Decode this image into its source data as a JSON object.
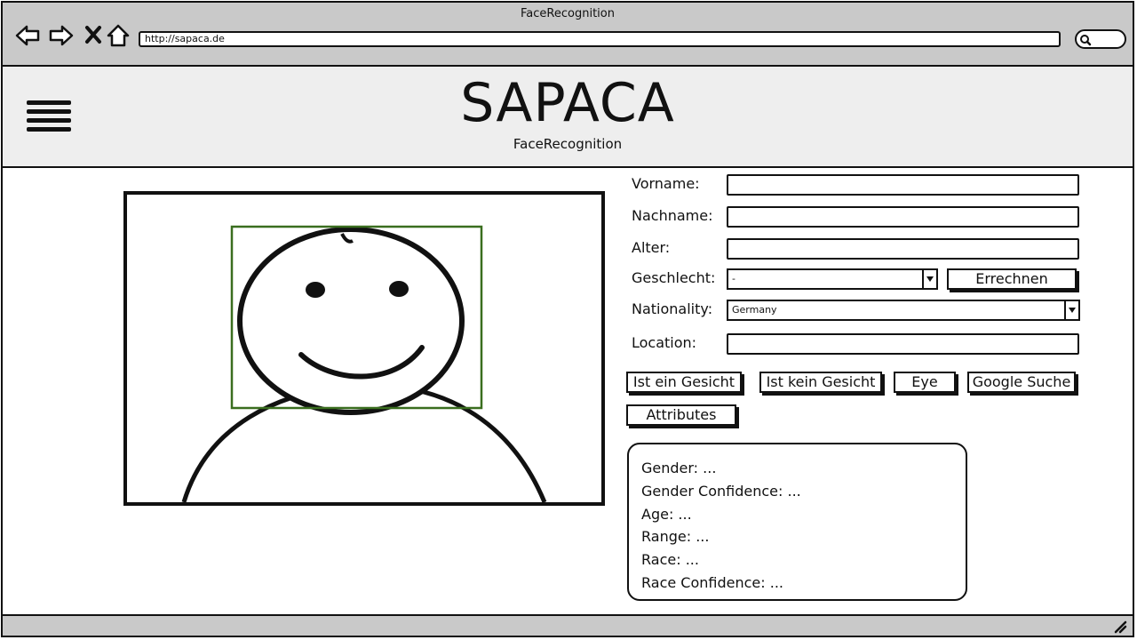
{
  "window": {
    "title": "FaceRecognition"
  },
  "browser": {
    "url": "http://sapaca.de"
  },
  "header": {
    "brand": "SAPACA",
    "subtitle": "FaceRecognition"
  },
  "form": {
    "vorname_label": "Vorname:",
    "nachname_label": "Nachname:",
    "alter_label": "Alter:",
    "geschlecht_label": "Geschlecht:",
    "geschlecht_value": "-",
    "errechnen_label": "Errechnen",
    "nationality_label": "Nationality:",
    "nationality_value": "Germany",
    "location_label": "Location:"
  },
  "actions": {
    "ist_ein_gesicht": "Ist ein Gesicht",
    "ist_kein_gesicht": "Ist kein Gesicht",
    "eye": "Eye",
    "google_suche": "Google Suche",
    "attributes": "Attributes"
  },
  "results": [
    "Gender: ...",
    "Gender Confidence: ...",
    "Age: ...",
    "Range: ...",
    "Race: ...",
    "Race Confidence: ..."
  ],
  "colors": {
    "chrome": "#c9c9c9",
    "header": "#eeeeee",
    "face_box": "#3a6e1f"
  }
}
